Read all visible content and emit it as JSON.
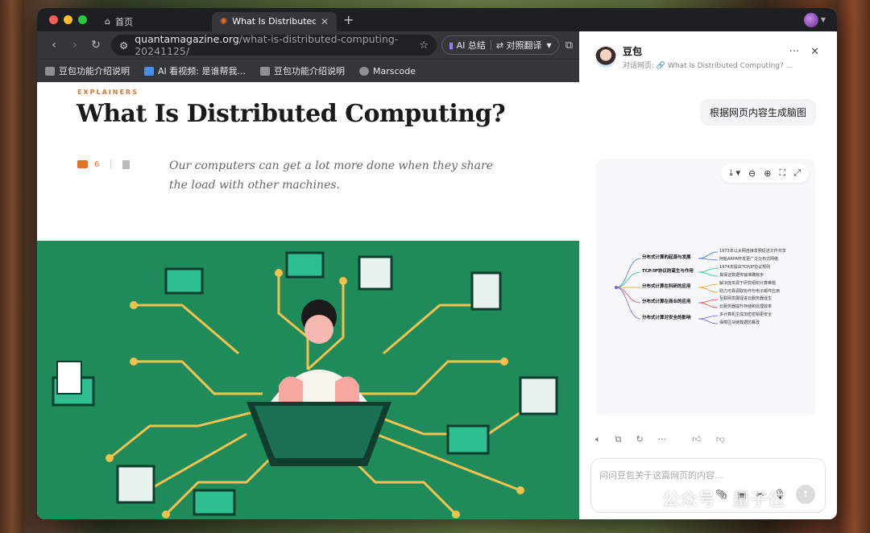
{
  "browser": {
    "tabs": [
      {
        "label": "首页",
        "icon": "home-icon"
      },
      {
        "label": "What Is Distributed Co",
        "icon": "quanta-favicon"
      }
    ],
    "new_tab": "+",
    "address": {
      "domain": "quantamagazine.org",
      "path": "/what-is-distributed-computing-20241125/"
    },
    "ai_summary": "AI 总结",
    "translate": "对照翻译",
    "bookmarks": [
      "豆包功能介绍说明",
      "AI 看视频: 是谁帮我...",
      "豆包功能介绍说明",
      "Marscode"
    ]
  },
  "article": {
    "kicker": "EXPLAINERS",
    "title": "What Is Distributed Computing?",
    "comments": "6",
    "dek": "Our computers can get a lot more done when they share the load with other machines."
  },
  "assistant": {
    "name": "豆包",
    "subtitle": "对话网页: 🔗 What Is Distributed Computing? ...",
    "user_message": "根据网页内容生成脑图",
    "mindmap": {
      "branches": [
        {
          "label": "分布式计算的起源与发展",
          "leaves": [
            "1973年以太网连接发明促进文件共享",
            "阿帕ARPA开发更广泛分布式网络"
          ]
        },
        {
          "label": "TCP/IP协议的诞生与作用",
          "leaves": [
            "1974年提出TCP/IP协议规则",
            "其保证数据传输准确有序"
          ]
        },
        {
          "label": "分布式计算在科研的应用",
          "leaves": [
            "解决庞资源于研究组织计算难题",
            "助力可靠调取协作与电子邮件应用"
          ]
        },
        {
          "label": "分布式计算在商业的应用",
          "leaves": [
            "互联网发展促进云服务器诞生",
            "云服务器提升存储和处理效率"
          ]
        },
        {
          "label": "分布式计算对安全的影响",
          "leaves": [
            "多计算机生成加密密钥更安全",
            "保障区块链数据防篡改"
          ]
        }
      ]
    },
    "input_placeholder": "问问豆包关于这篇网页的内容..."
  },
  "watermark": "公众号 · 量子位",
  "colors": {
    "accent": "#e0742a",
    "hero_green": "#1f8a5a",
    "branch_colors": [
      "#4a6cf7",
      "#2ec27e",
      "#e0a020",
      "#e24a4a",
      "#7a5af8"
    ]
  }
}
